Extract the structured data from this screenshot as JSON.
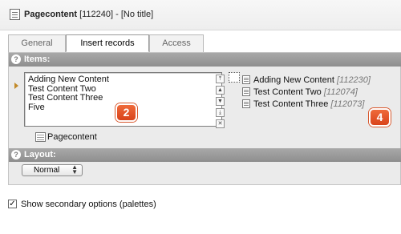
{
  "header": {
    "title_bold": "Pagecontent",
    "title_rest": " [112240] - [No title]",
    "icon": "page-icon"
  },
  "tabs": [
    {
      "label": "General",
      "active": false
    },
    {
      "label": "Insert records",
      "active": true
    },
    {
      "label": "Access",
      "active": false
    }
  ],
  "items_section": {
    "help_icon": "?",
    "heading": "Items:",
    "list_options": [
      "Adding New Content",
      "Test Content Two",
      "Test Content Three",
      "Five"
    ],
    "side_buttons": [
      "move-top",
      "move-up",
      "move-down",
      "move-bottom",
      "remove"
    ],
    "records": [
      {
        "title": "Adding New Content",
        "uid": "[112230]"
      },
      {
        "title": "Test Content Two",
        "uid": "[112074]"
      },
      {
        "title": "Test Content Three",
        "uid": "[112073]"
      }
    ],
    "table_label": "Pagecontent"
  },
  "callouts": [
    "2",
    "4"
  ],
  "layout_section": {
    "help_icon": "?",
    "heading": "Layout:",
    "selected": "Normal",
    "caret": "▲▼"
  },
  "secondary_options": {
    "checked": true,
    "check_glyph": "✓",
    "label": "Show secondary options (palettes)"
  }
}
